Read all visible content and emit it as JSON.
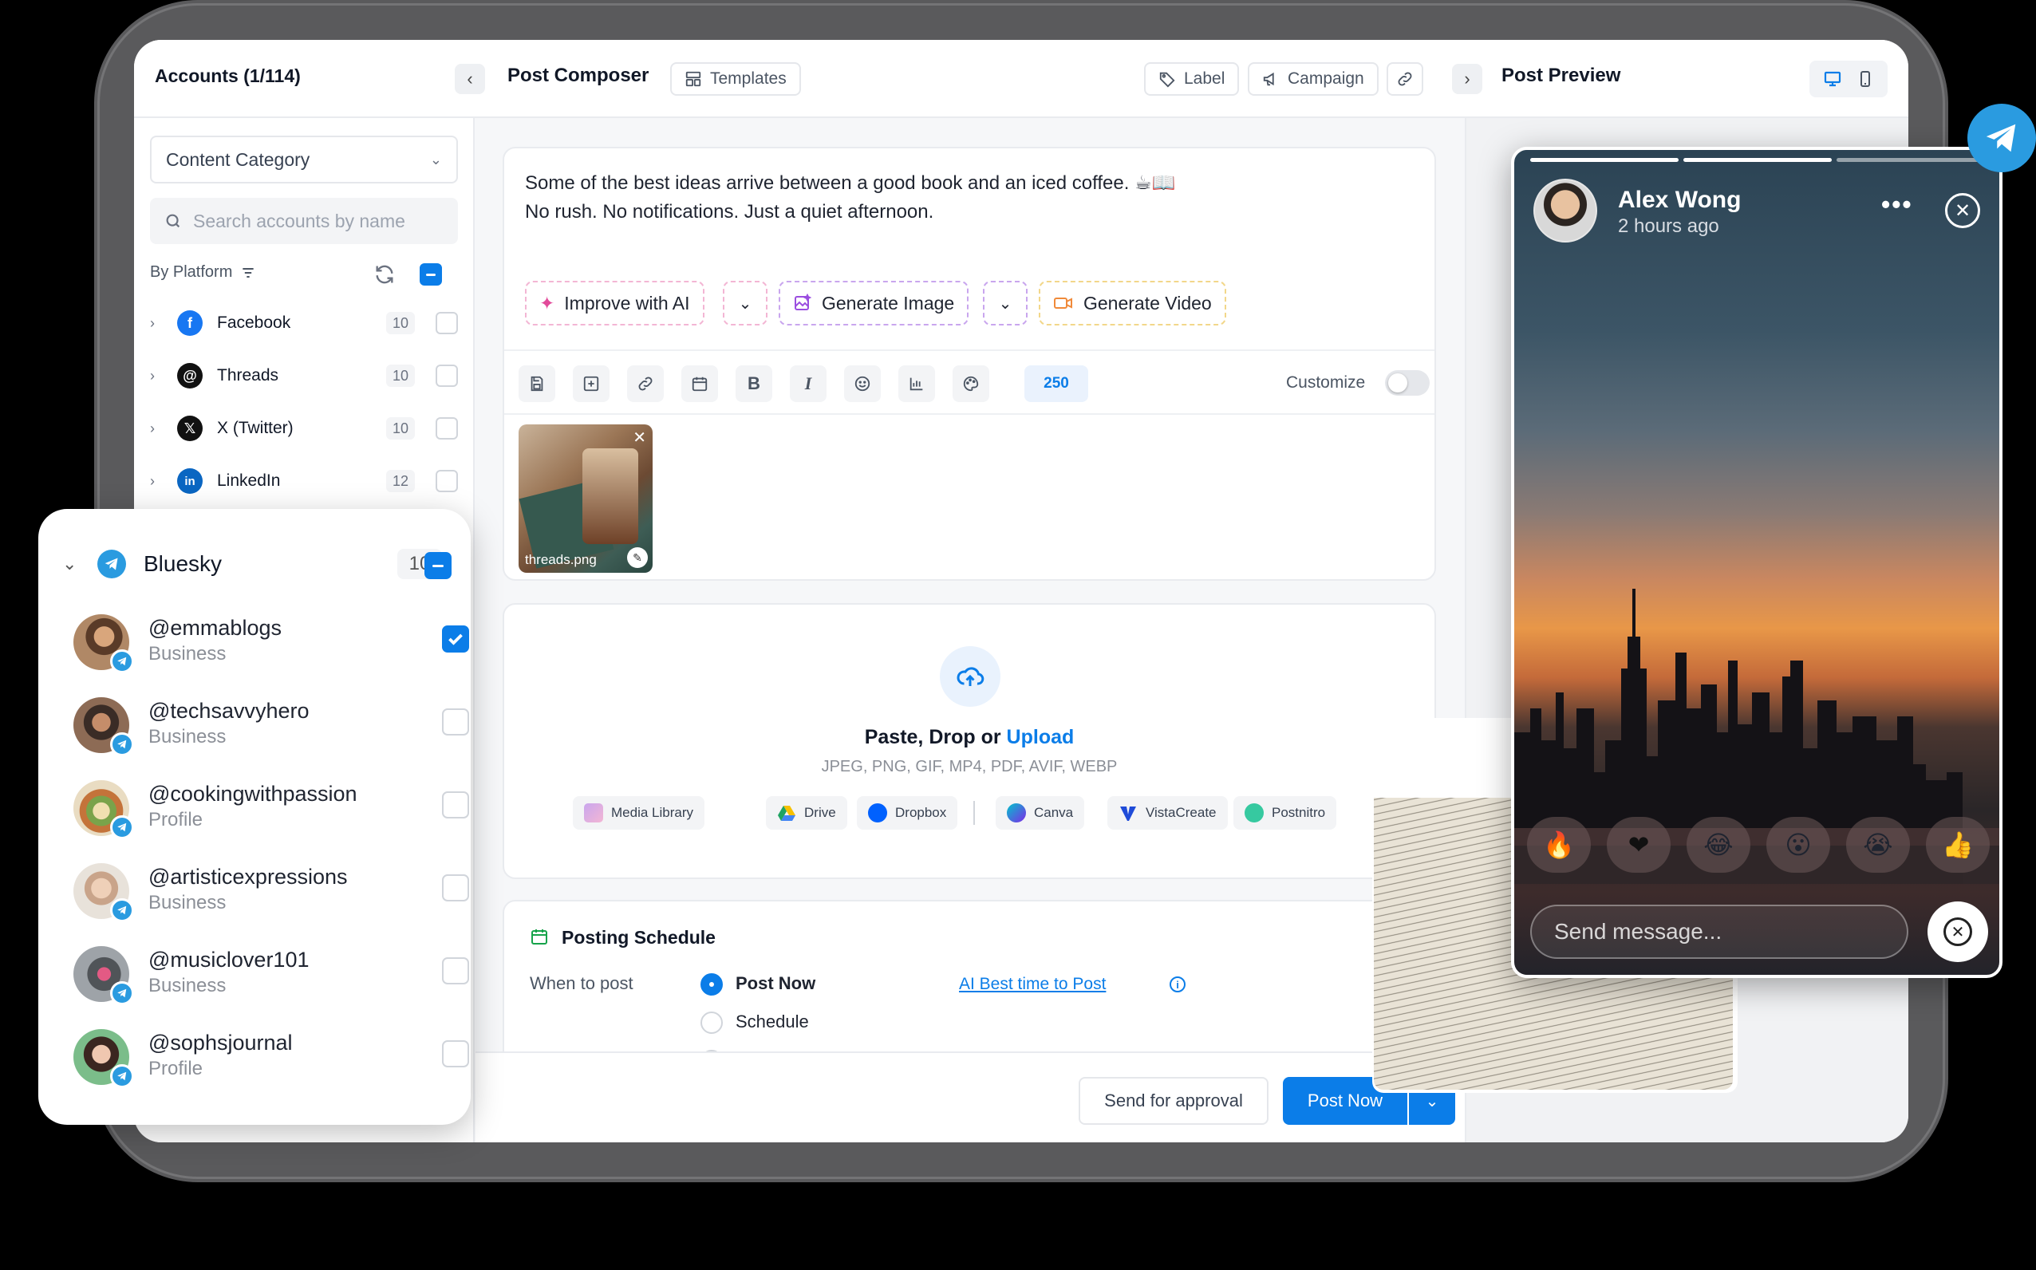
{
  "header": {
    "accounts_title": "Accounts (1/114)",
    "composer_title": "Post Composer",
    "templates_label": "Templates",
    "label_label": "Label",
    "campaign_label": "Campaign",
    "preview_title": "Post Preview"
  },
  "sidebar": {
    "category_select": "Content Category",
    "search_placeholder": "Search accounts by name",
    "by_platform": "By Platform",
    "platforms": [
      {
        "name": "Facebook",
        "count": "10",
        "color": "#1877f2"
      },
      {
        "name": "Threads",
        "count": "10",
        "color": "#111111"
      },
      {
        "name": "X (Twitter)",
        "count": "10",
        "color": "#111111"
      },
      {
        "name": "LinkedIn",
        "count": "12",
        "color": "#0a66c2"
      }
    ]
  },
  "bluesky": {
    "name": "Bluesky",
    "count": "10",
    "accounts": [
      {
        "handle": "@emmablogs",
        "type": "Business",
        "checked": true
      },
      {
        "handle": "@techsavvyhero",
        "type": "Business",
        "checked": false
      },
      {
        "handle": "@cookingwithpassion",
        "type": "Profile",
        "checked": false
      },
      {
        "handle": "@artisticexpressions",
        "type": "Business",
        "checked": false
      },
      {
        "handle": "@musiclover101",
        "type": "Business",
        "checked": false
      },
      {
        "handle": "@sophsjournal",
        "type": "Profile",
        "checked": false
      }
    ]
  },
  "editor": {
    "line1": "Some of the best ideas arrive between a good book and an iced coffee. ☕📖",
    "line2": "No rush. No notifications. Just a quiet afternoon.",
    "improve_ai": "Improve with AI",
    "generate_image": "Generate Image",
    "generate_video": "Generate Video",
    "char_count": "250",
    "customize": "Customize",
    "attachment_name": "threads.png"
  },
  "upload": {
    "title_prefix": "Paste, Drop or ",
    "title_link": "Upload",
    "formats": "JPEG, PNG, GIF, MP4, PDF, AVIF, WEBP",
    "sources": [
      "Media Library",
      "Drive",
      "Dropbox",
      "Canva",
      "VistaCreate",
      "Postnitro"
    ]
  },
  "schedule": {
    "title": "Posting Schedule",
    "when_label": "When to post",
    "post_now": "Post Now",
    "ai_best_time": "AI Best time to Post",
    "schedule_option": "Schedule"
  },
  "footer": {
    "send_approval": "Send for approval",
    "post_now": "Post Now"
  },
  "preview": {
    "name": "Alex Wong",
    "time": "2 hours ago",
    "reactions": [
      "🔥",
      "❤",
      "😂",
      "😮",
      "😭",
      "👍"
    ],
    "message_placeholder": "Send message..."
  },
  "colors": {
    "accent": "#0b7de8",
    "telegram": "#2a9be0"
  }
}
